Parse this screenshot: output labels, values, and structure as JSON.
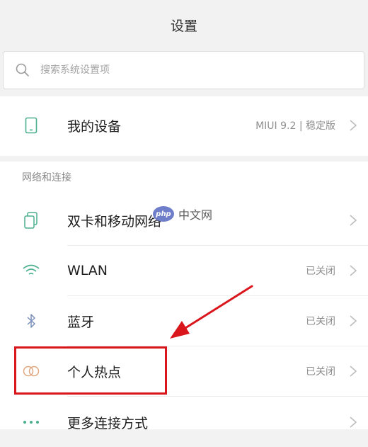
{
  "header": {
    "title": "设置"
  },
  "search": {
    "placeholder": "搜索系统设置项"
  },
  "device": {
    "label": "我的设备",
    "value": "MIUI 9.2 | 稳定版"
  },
  "section": {
    "title": "网络和连接"
  },
  "items": [
    {
      "label": "双卡和移动网络",
      "value": "",
      "icon": "dual-sim-icon"
    },
    {
      "label": "WLAN",
      "value": "已关闭",
      "icon": "wifi-icon"
    },
    {
      "label": "蓝牙",
      "value": "已关闭",
      "icon": "bluetooth-icon"
    },
    {
      "label": "个人热点",
      "value": "已关闭",
      "icon": "hotspot-icon"
    },
    {
      "label": "更多连接方式",
      "value": "",
      "icon": "more-icon"
    }
  ],
  "watermark": {
    "logo_text": "php",
    "text": "中文网"
  },
  "colors": {
    "accent": "#4caf8e",
    "annotation": "#d8161c"
  }
}
